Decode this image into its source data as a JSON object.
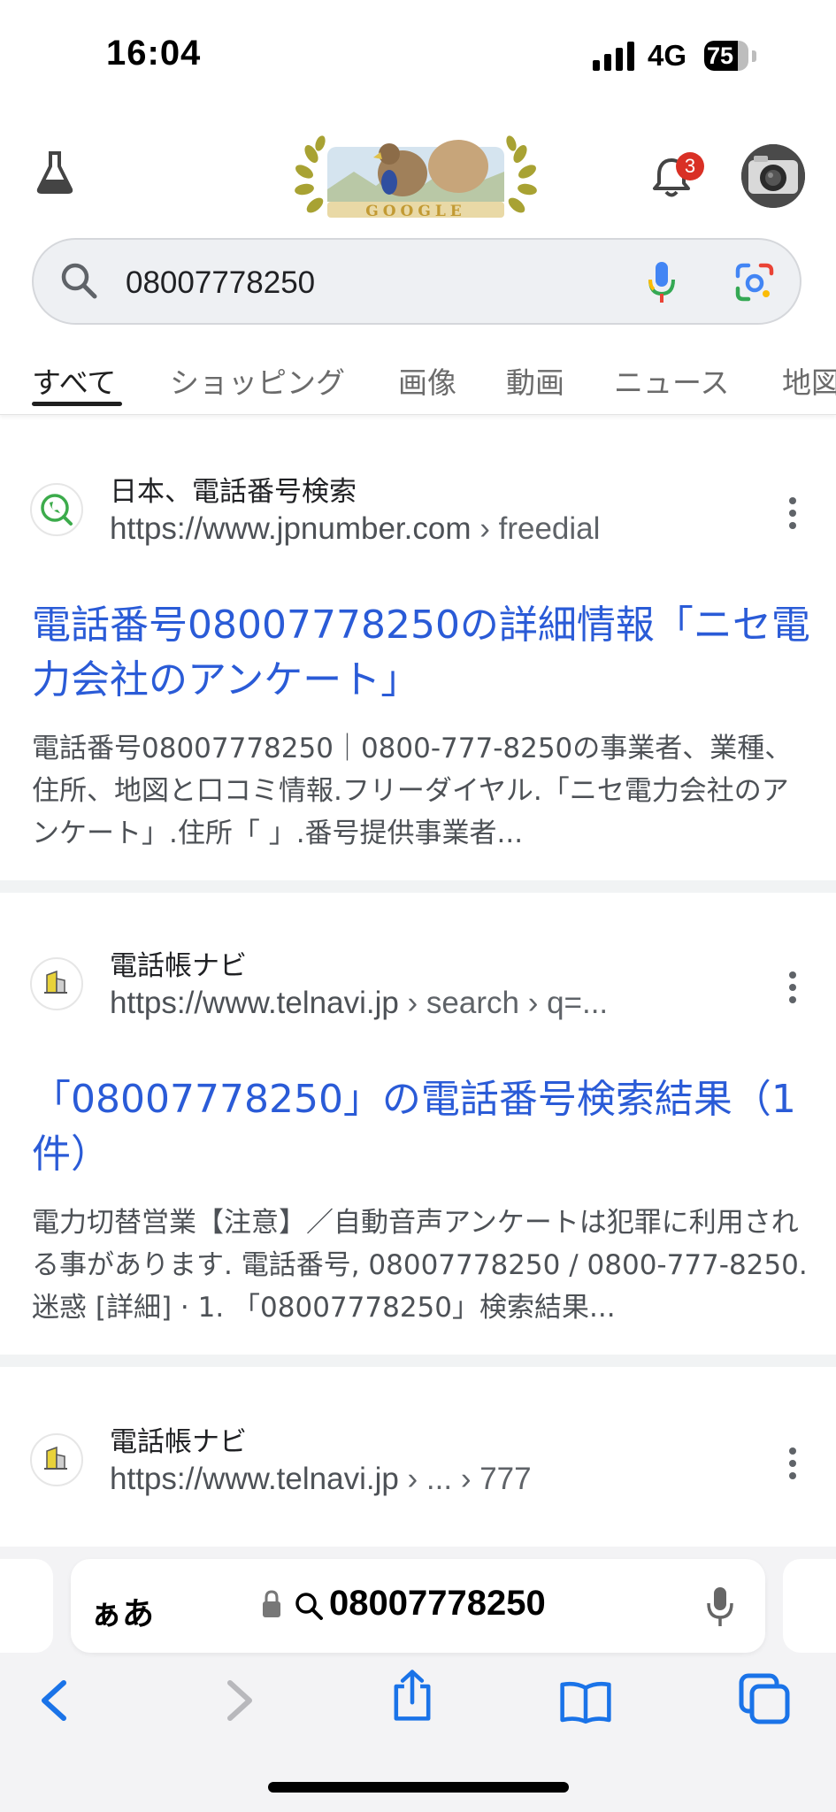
{
  "status": {
    "time": "16:04",
    "network": "4G",
    "battery": "75",
    "battery_level": 0.75
  },
  "header": {
    "labs_icon": "flask-icon",
    "doodle_text": "GOOGLE",
    "notifications_count": "3",
    "avatar_icon": "camera-avatar"
  },
  "search": {
    "query": "08007778250"
  },
  "tabs": [
    {
      "label": "すべて",
      "active": true
    },
    {
      "label": "ショッピング"
    },
    {
      "label": "画像"
    },
    {
      "label": "動画"
    },
    {
      "label": "ニュース"
    },
    {
      "label": "地図"
    }
  ],
  "results": [
    {
      "site_name": "日本、電話番号検索",
      "url_domain": "https://www.jpnumber.com",
      "url_path": " › freedial",
      "title": "電話番号08007778250の詳細情報「ニセ電力会社のアンケート」",
      "snippet": "電話番号08007778250｜0800-777-8250の事業者、業種、住所、地図と口コミ情報.フリーダイヤル.「ニセ電力会社のアンケート」.住所「 」.番号提供事業者..."
    },
    {
      "site_name": "電話帳ナビ",
      "url_domain": "https://www.telnavi.jp",
      "url_path": " › search › q=...",
      "title": "「08007778250」の電話番号検索結果（1件）",
      "snippet": "電力切替営業【注意】／自動音声アンケートは犯罪に利用される事があります. 電話番号, 08007778250 / 0800-777-8250. 迷惑 [詳細] · 1. 「08007778250」検索結果..."
    },
    {
      "site_name": "電話帳ナビ",
      "url_domain": "https://www.telnavi.jp",
      "url_path": " › ... › 777"
    }
  ],
  "safari": {
    "aa_label": "ぁあ",
    "address_text": "08007778250",
    "nav_icons": [
      "back-icon",
      "forward-icon",
      "share-icon",
      "bookmarks-icon",
      "tabs-icon"
    ]
  },
  "colors": {
    "link": "#2a5bd7",
    "badge": "#d93025",
    "accent": "#1a73e8"
  }
}
